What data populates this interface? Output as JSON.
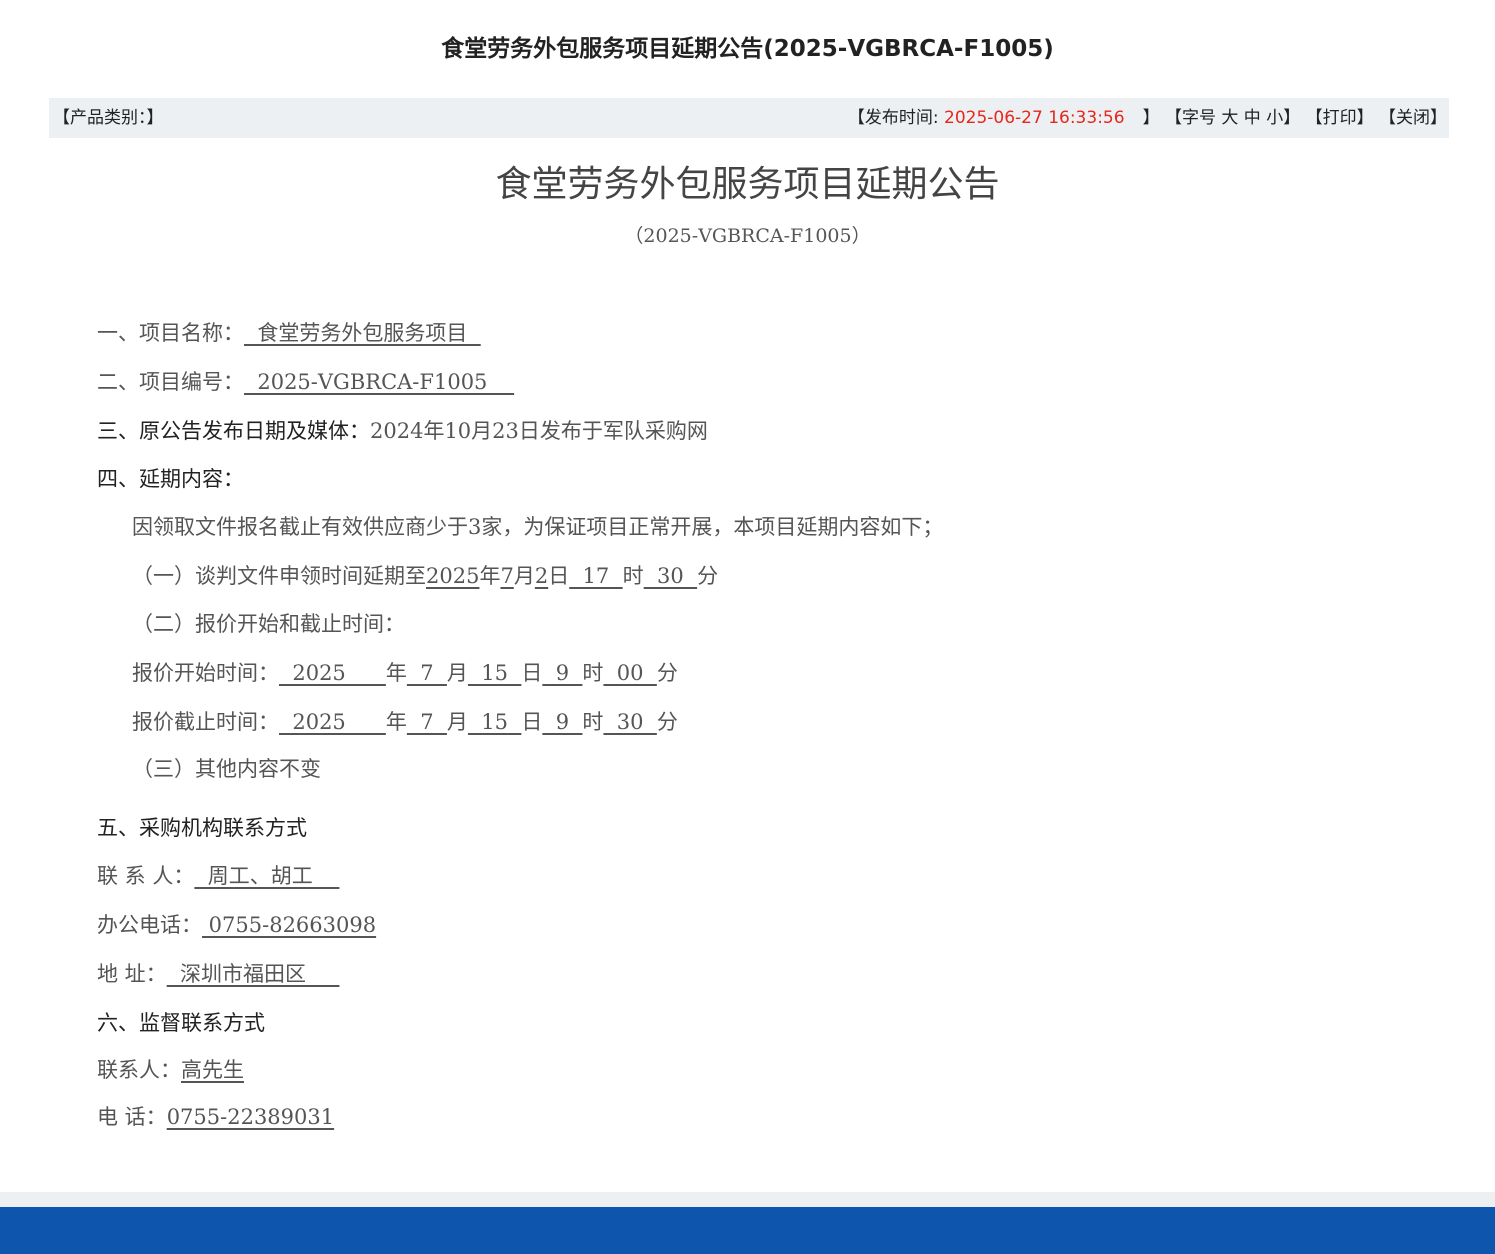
{
  "header": {
    "page_title": "食堂劳务外包服务项目延期公告(2025-VGBRCA-F1005)"
  },
  "infobar": {
    "category": "【产品类别：】",
    "publish_label": "【发布时间: ",
    "publish_date": "2025-06-27 16:33:56",
    "publish_close": "】",
    "font_size_label": "【字号",
    "font_large": "大",
    "font_medium": "中",
    "font_small": "小",
    "font_close": "】",
    "print": "【打印】",
    "close": "【关闭】"
  },
  "doc": {
    "title": "食堂劳务外包服务项目延期公告",
    "code": "（2025-VGBRCA-F1005）",
    "s1_label": "一、项目名称：",
    "s1_value": "  食堂劳务外包服务项目  ",
    "s2_label": "二、项目编号：",
    "s2_value": "  2025-VGBRCA-F1005    ",
    "s3_label": "三、原公告发布日期及媒体：",
    "s3_value": "2024年10月23日发布于军队采购网",
    "s4_label": "四、延期内容：",
    "s4_intro": "因领取文件报名截止有效供应商少于3家，为保证项目正常开展，本项目延期内容如下；",
    "s4_item1": {
      "prefix": "（一）谈判文件申领时间延期至",
      "year": "2025",
      "t1": "年",
      "month": "7",
      "t2": "月",
      "day": "2",
      "t3": "日",
      "hour": "  17  ",
      "t4": "时",
      "minute": "  30  ",
      "t5": "分"
    },
    "s4_item2": "（二）报价开始和截止时间：",
    "quote_start": {
      "label": "报价开始时间：",
      "year": "  2025      ",
      "t1": "年",
      "month": "  7  ",
      "t2": "月",
      "day": "  15  ",
      "t3": "日",
      "hour": "  9  ",
      "t4": "时",
      "minute": "  00  ",
      "t5": "分"
    },
    "quote_end": {
      "label": "报价截止时间：",
      "year": "  2025      ",
      "t1": "年",
      "month": "  7  ",
      "t2": "月",
      "day": "  15  ",
      "t3": "日",
      "hour": "  9  ",
      "t4": "时",
      "minute": "  30  ",
      "t5": "分"
    },
    "s4_item3": "（三）其他内容不变",
    "s5_label": "五、采购机构联系方式",
    "contact_label": "联 系 人：",
    "contact_value": "  周工、胡工    ",
    "phone_label": "办公电话：",
    "phone_value": " 0755-82663098",
    "address_label": "地      址：",
    "address_value": "  深圳市福田区     ",
    "s6_label": "六、监督联系方式",
    "sup_contact_label": "联系人：",
    "sup_contact_value": "高先生",
    "sup_phone_label": "电  话：",
    "sup_phone_value": "0755-22389031"
  }
}
